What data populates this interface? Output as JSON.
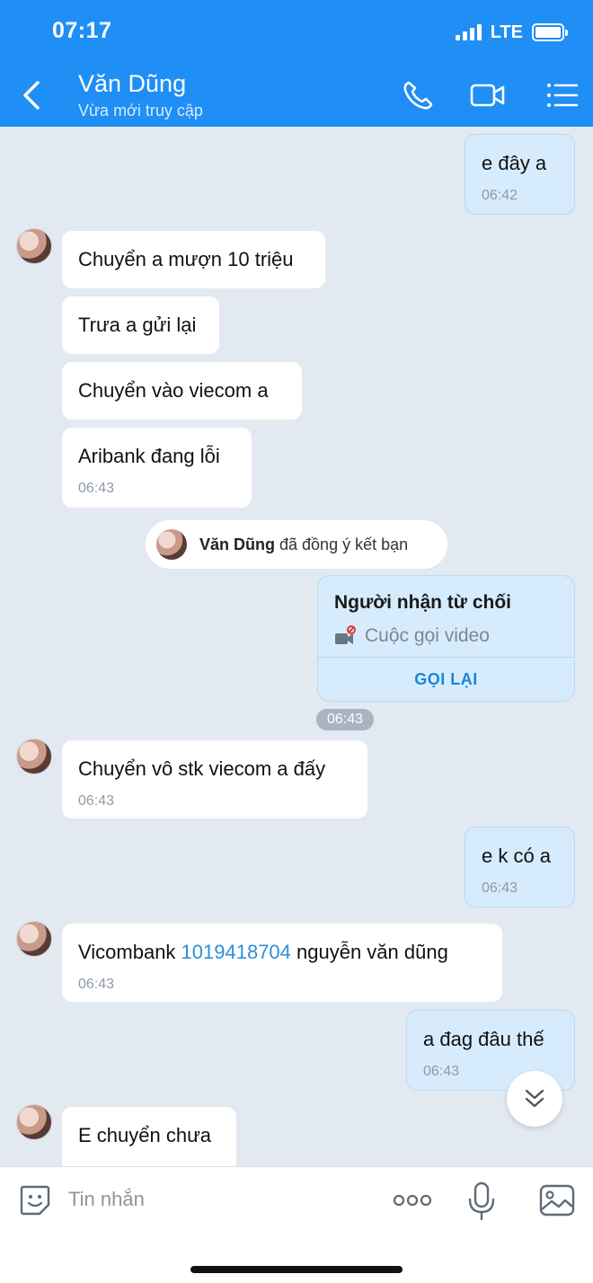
{
  "status_bar": {
    "time": "07:17",
    "network": "LTE"
  },
  "header": {
    "title": "Văn Dũng",
    "subtitle": "Vừa mới truy cập",
    "icons": [
      "back-icon",
      "phone-icon",
      "video-call-icon",
      "menu-icon"
    ]
  },
  "messages": [
    {
      "dir": "out",
      "text": "e đây a",
      "time": "06:42"
    },
    {
      "dir": "in",
      "text": "Chuyển a mượn 10 triệu"
    },
    {
      "dir": "in",
      "text": "Trưa a gửi lại"
    },
    {
      "dir": "in",
      "text": "Chuyển vào viecom a"
    },
    {
      "dir": "in",
      "text": "Aribank đang lỗi",
      "time": "06:43"
    },
    {
      "dir": "in",
      "text": "Chuyển vô stk viecom a đấy",
      "time": "06:43"
    },
    {
      "dir": "out",
      "text": "e k có a",
      "time": "06:43"
    },
    {
      "dir": "in",
      "text_before": "Vicombank ",
      "link": "1019418704",
      "text_after": " nguyễn văn dũng",
      "time": "06:43"
    },
    {
      "dir": "out",
      "text": "a đag đâu thế",
      "time": "06:43"
    },
    {
      "dir": "in",
      "text": "E chuyển chưa"
    }
  ],
  "system_notice": {
    "name": "Văn Dũng",
    "text": "đã đồng ý kết bạn"
  },
  "call_card": {
    "title": "Người nhận từ chối",
    "subtitle": "Cuộc gọi video",
    "action": "GỌI LẠI",
    "time": "06:43"
  },
  "input": {
    "placeholder": "Tin nhắn"
  },
  "colors": {
    "header": "#1f8ef5",
    "chat_bg": "#e2e9f1",
    "bubble_out": "#d6ecfd",
    "link": "#2d8fd8"
  }
}
